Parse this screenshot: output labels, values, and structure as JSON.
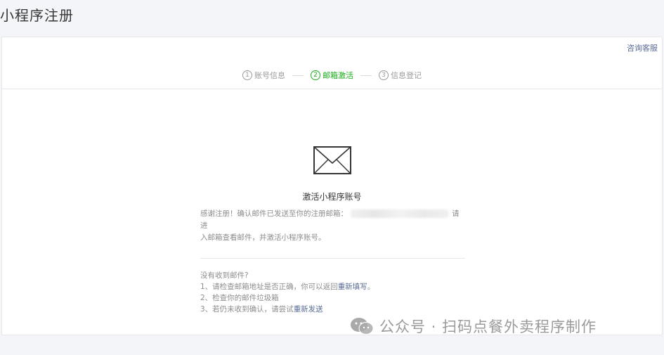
{
  "page": {
    "title": "小程序注册"
  },
  "header": {
    "service_link": "咨询客服"
  },
  "steps": [
    {
      "num": "1",
      "label": "账号信息",
      "active": false
    },
    {
      "num": "2",
      "label": "邮箱激活",
      "active": true
    },
    {
      "num": "3",
      "label": "信息登记",
      "active": false
    }
  ],
  "activation": {
    "icon": "envelope-icon",
    "title": "激活小程序账号",
    "desc_prefix": "感谢注册！确认邮件已发送至你的注册邮箱：",
    "desc_suffix_1": "请进",
    "desc_line2": "入邮箱查看邮件，并激活小程序账号。"
  },
  "help": {
    "heading": "没有收到邮件?",
    "item1_text": "1、请检查邮箱地址是否正确，你可以返回",
    "item1_link": "重新填写",
    "item1_end": "。",
    "item2_text": "2、检查你的邮件垃圾箱",
    "item3_text": "3、若仍未收到确认，请尝试",
    "item3_link": "重新发送"
  },
  "watermark": {
    "icon": "wechat-icon",
    "text": "公众号 · 扫码点餐外卖程序制作"
  },
  "colors": {
    "accent_green": "#1aad19",
    "link_blue": "#576b95",
    "muted_gray": "#8d8d8d"
  }
}
